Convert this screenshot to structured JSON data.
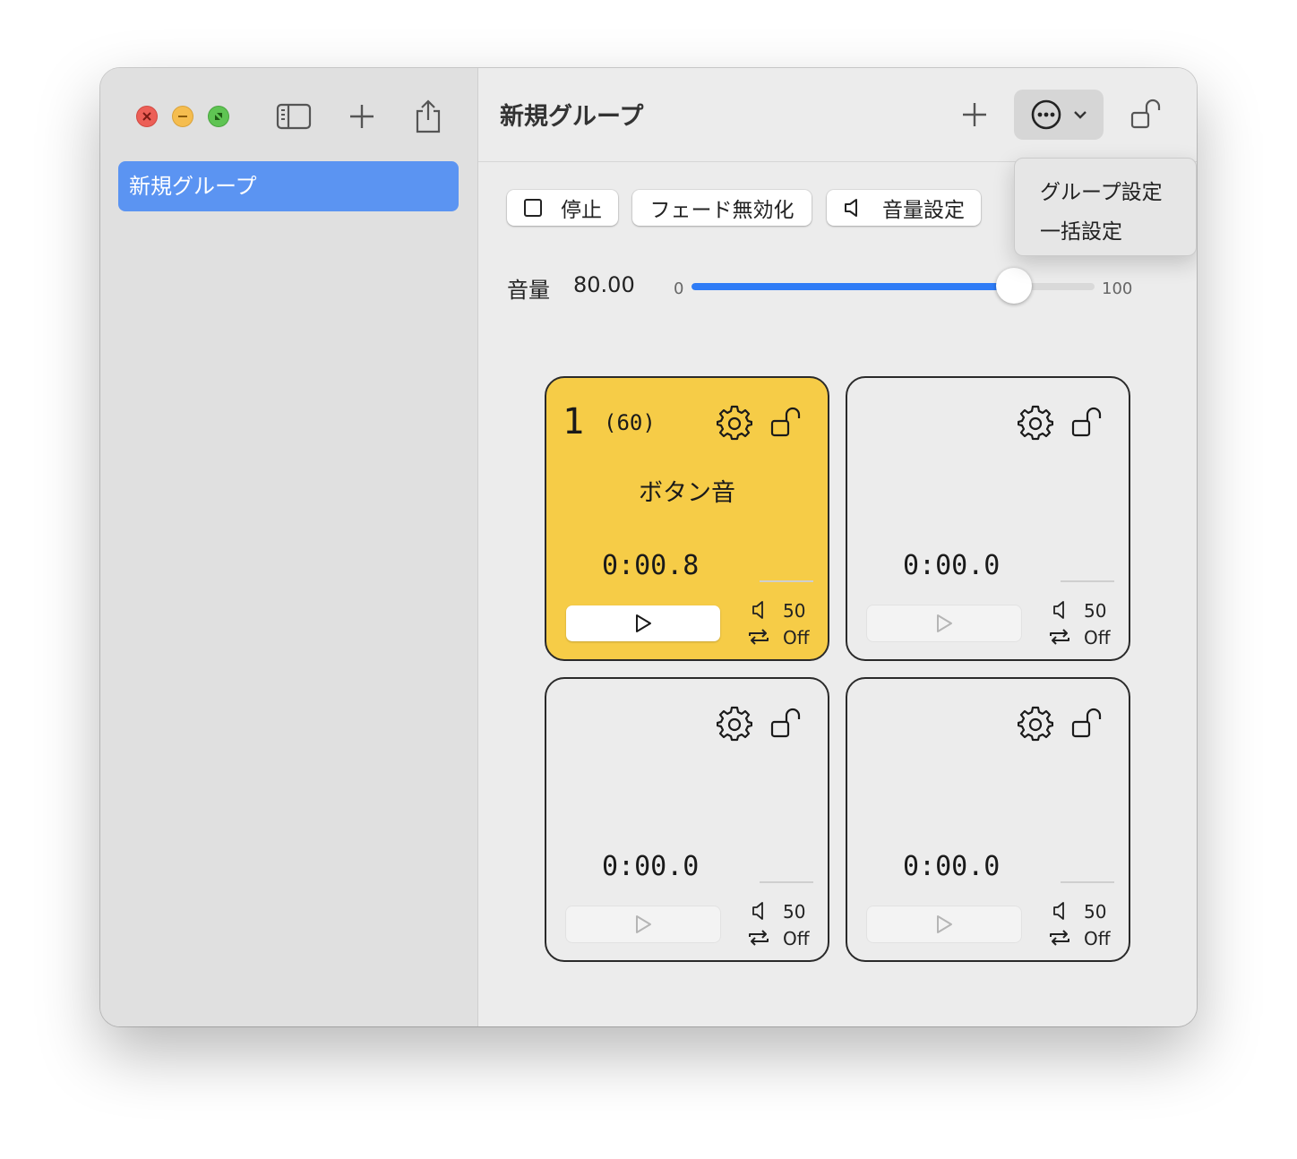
{
  "sidebar": {
    "items": [
      {
        "label": "新規グループ",
        "selected": true
      }
    ]
  },
  "header": {
    "title": "新規グループ"
  },
  "menu": {
    "items": [
      {
        "label": "グループ設定"
      },
      {
        "label": "一括設定"
      }
    ]
  },
  "controls": {
    "stop_label": "停止",
    "fade_label": "フェード無効化",
    "volume_setting_label": "音量設定"
  },
  "volume": {
    "label": "音量",
    "value": "80.00",
    "min": "0",
    "max": "100",
    "level": 0.8
  },
  "colors": {
    "accent": "#2f7cf6",
    "selection": "#5b94f2",
    "active_card": "#f6cc47"
  },
  "cards": [
    {
      "number": "1",
      "count": "(60)",
      "name": "ボタン音",
      "time": "0:00.8",
      "volume": "50",
      "loop": "Off",
      "active": true
    },
    {
      "number": "",
      "count": "",
      "name": "",
      "time": "0:00.0",
      "volume": "50",
      "loop": "Off",
      "active": false
    },
    {
      "number": "",
      "count": "",
      "name": "",
      "time": "0:00.0",
      "volume": "50",
      "loop": "Off",
      "active": false
    },
    {
      "number": "",
      "count": "",
      "name": "",
      "time": "0:00.0",
      "volume": "50",
      "loop": "Off",
      "active": false
    }
  ]
}
